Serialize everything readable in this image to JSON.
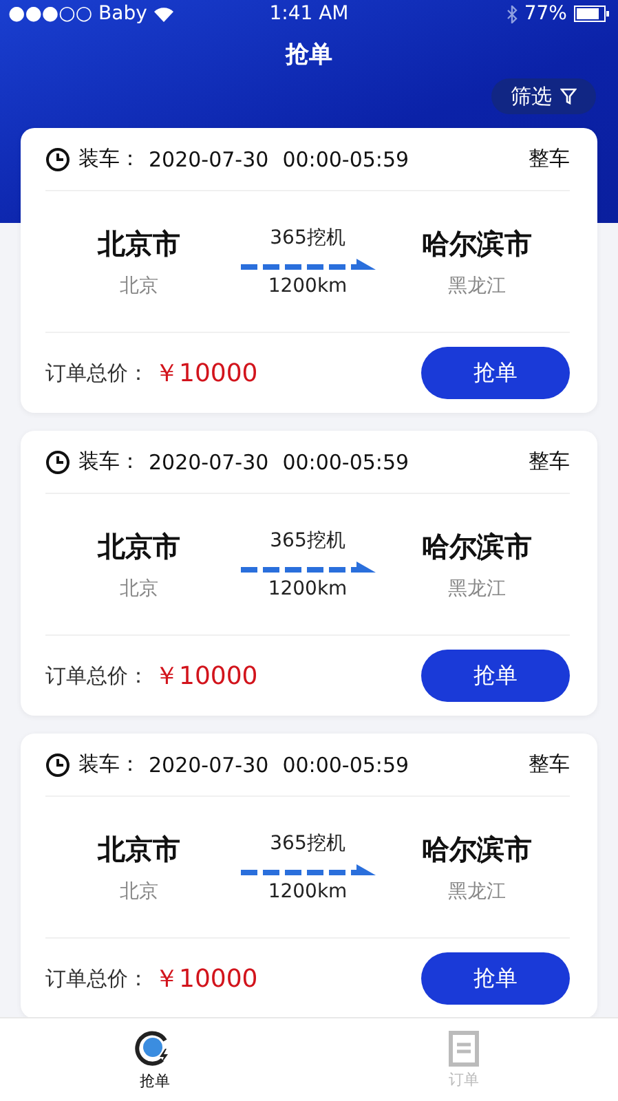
{
  "status_bar": {
    "carrier": "●●●○○ Baby",
    "time": "1:41 AM",
    "battery": "77%"
  },
  "header": {
    "title": "抢单",
    "filter_button": "筛选"
  },
  "orders": [
    {
      "load_label": "装车：",
      "date": "2020-07-30",
      "time_range": "00:00-05:59",
      "vehicle": "整车",
      "origin_city": "北京市",
      "origin_province": "北京",
      "cargo": "365挖机",
      "distance": "1200km",
      "dest_city": "哈尔滨市",
      "dest_province": "黑龙江",
      "price_label": "订单总价：",
      "price": "￥10000",
      "action": "抢单"
    },
    {
      "load_label": "装车：",
      "date": "2020-07-30",
      "time_range": "00:00-05:59",
      "vehicle": "整车",
      "origin_city": "北京市",
      "origin_province": "北京",
      "cargo": "365挖机",
      "distance": "1200km",
      "dest_city": "哈尔滨市",
      "dest_province": "黑龙江",
      "price_label": "订单总价：",
      "price": "￥10000",
      "action": "抢单"
    },
    {
      "load_label": "装车：",
      "date": "2020-07-30",
      "time_range": "00:00-05:59",
      "vehicle": "整车",
      "origin_city": "北京市",
      "origin_province": "北京",
      "cargo": "365挖机",
      "distance": "1200km",
      "dest_city": "哈尔滨市",
      "dest_province": "黑龙江",
      "price_label": "订单总价：",
      "price": "￥10000",
      "action": "抢单"
    }
  ],
  "tab_bar": [
    {
      "label": "抢单",
      "kind": "grab",
      "selected": true
    },
    {
      "label": "订单",
      "kind": "orders",
      "selected": false
    }
  ]
}
